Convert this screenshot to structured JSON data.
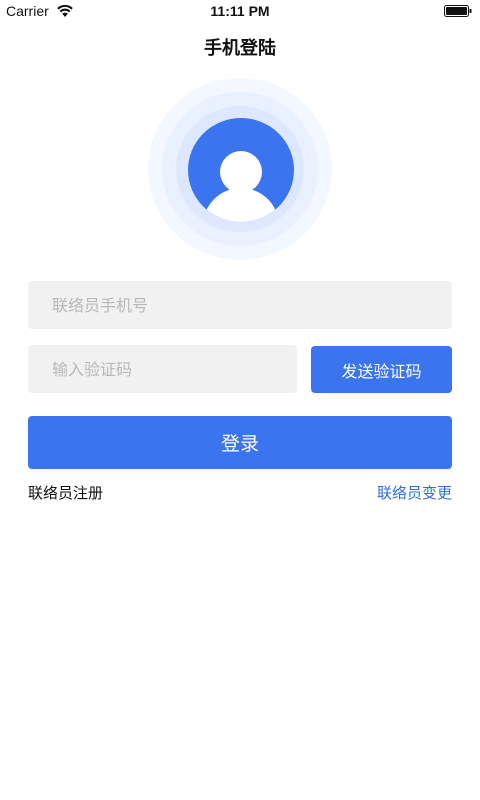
{
  "status_bar": {
    "carrier": "Carrier",
    "time": "11:11 PM",
    "wifi_icon": "wifi-icon",
    "battery_icon": "battery-icon"
  },
  "header": {
    "title": "手机登陆"
  },
  "avatar": {
    "icon": "user-avatar-icon",
    "color": "#3a74ee"
  },
  "form": {
    "phone_placeholder": "联络员手机号",
    "phone_value": "",
    "code_placeholder": "输入验证码",
    "code_value": "",
    "send_code_label": "发送验证码",
    "login_label": "登录"
  },
  "links": {
    "register": "联络员注册",
    "change": "联络员变更"
  },
  "colors": {
    "accent": "#3a74ee",
    "link": "#2f6fe0",
    "input_bg": "#f1f1f1"
  }
}
